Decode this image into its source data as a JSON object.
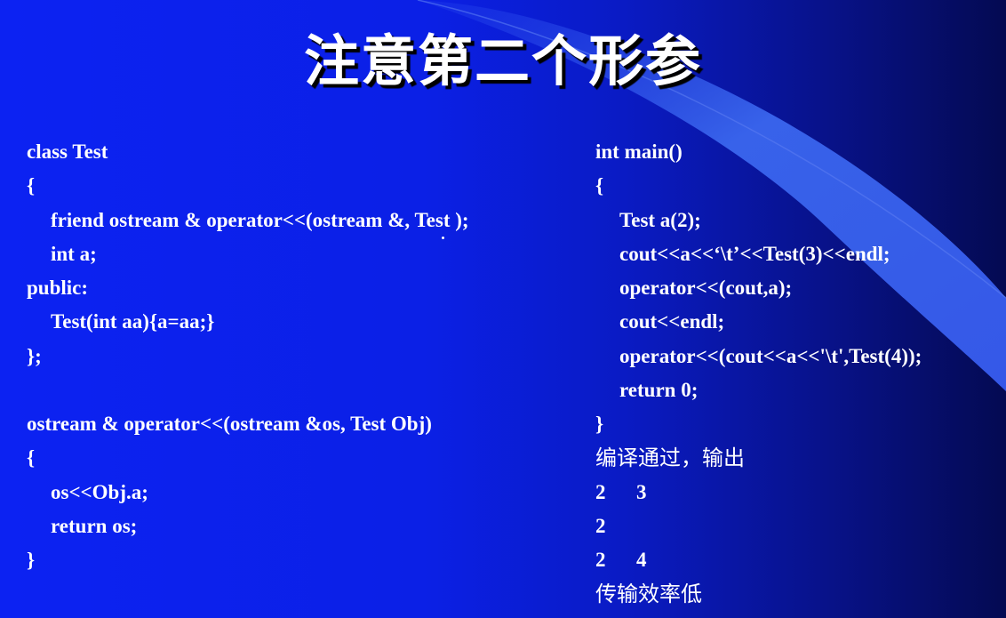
{
  "slide": {
    "title": "注意第二个形参",
    "left_code": [
      "class Test",
      "{",
      "friend ostream & operator<<(ostream &, Test );",
      "int a;",
      "public:",
      "Test(int aa){a=aa;}",
      "};",
      "",
      "ostream & operator<<(ostream &os, Test Obj)",
      "{",
      "os<<Obj.a;",
      "return os;",
      "}"
    ],
    "right_code": [
      "int main()",
      "{",
      "Test a(2);",
      "cout<<a<<‘\\t’<<Test(3)<<endl;",
      "operator<<(cout,a);",
      "cout<<endl;",
      "operator<<(cout<<a<<'\\t',Test(4));",
      "return 0;",
      "}"
    ],
    "compile_note": "编译通过，输出",
    "output_lines": [
      "2      3",
      "2",
      "2      4"
    ],
    "efficiency_note": "传输效率低"
  },
  "colors": {
    "background_left": "#0c22f2",
    "background_right": "#040a52",
    "swoosh": "#3a66ee",
    "text": "#ffffff"
  }
}
